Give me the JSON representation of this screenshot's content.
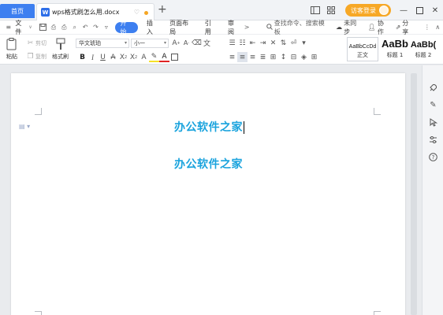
{
  "titlebar": {
    "home_tab": "首页",
    "doc_tab": "wps格式刷怎么用.docx",
    "doc_tab_ctrl": "♡ ·",
    "add_tab": "+",
    "login_button": "访客登录",
    "icons": [
      "layout-icon",
      "grid-icon",
      "minimize-icon",
      "maximize-icon",
      "close-icon"
    ]
  },
  "menubar": {
    "file": "文件",
    "items": [
      "开始",
      "插入",
      "页面布局",
      "引用",
      "审阅"
    ],
    "more": ">",
    "search": "查找命令、搜索模板",
    "unsync": "未同步",
    "collab": "协作",
    "share": "分享"
  },
  "ribbon": {
    "paste": "粘贴",
    "cut": "剪切",
    "copy": "复制",
    "format_painter": "格式刷",
    "font_name": "华文琥珀",
    "font_size": "小一",
    "styles": [
      {
        "preview": "AaBbCcDd",
        "label": "正文"
      },
      {
        "preview": "AaBb",
        "label": "标题 1"
      },
      {
        "preview": "AaBb(",
        "label": "标题 2"
      }
    ]
  },
  "document": {
    "line1": "办公软件之家",
    "line2": "办公软件之家"
  },
  "colors": {
    "accent": "#3d7ff0",
    "text_blue": "#1aa3dd",
    "login_orange": "#f7a826"
  }
}
